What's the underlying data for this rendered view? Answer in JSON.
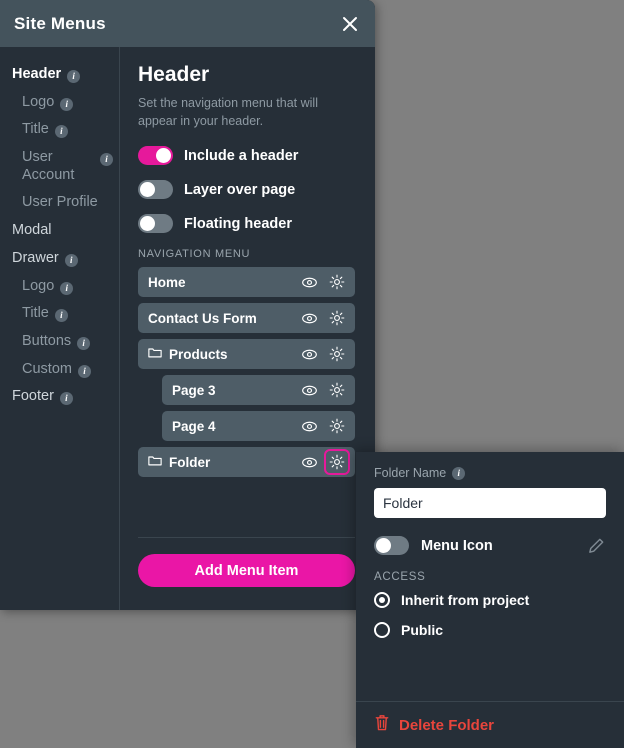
{
  "colors": {
    "accent": "#e6199b",
    "panel_bg": "#262f38",
    "header_bg": "#44535c",
    "row_bg": "#4e5d67",
    "danger": "#e8453c",
    "backdrop": "#808080"
  },
  "dialog": {
    "title": "Site Menus",
    "close_icon": "close-icon"
  },
  "sidebar": {
    "items": [
      {
        "label": "Header",
        "level": 0,
        "active": true,
        "info": true
      },
      {
        "label": "Logo",
        "level": 1,
        "active": false,
        "info": true
      },
      {
        "label": "Title",
        "level": 1,
        "active": false,
        "info": true
      },
      {
        "label": "User Account",
        "level": 1,
        "active": false,
        "info": true
      },
      {
        "label": "User Profile",
        "level": 1,
        "active": false,
        "info": false
      },
      {
        "label": "Modal",
        "level": 0,
        "active": false,
        "info": false
      },
      {
        "label": "Drawer",
        "level": 0,
        "active": false,
        "info": true
      },
      {
        "label": "Logo",
        "level": 1,
        "active": false,
        "info": true
      },
      {
        "label": "Title",
        "level": 1,
        "active": false,
        "info": true
      },
      {
        "label": "Buttons",
        "level": 1,
        "active": false,
        "info": true
      },
      {
        "label": "Custom",
        "level": 1,
        "active": false,
        "info": true
      },
      {
        "label": "Footer",
        "level": 0,
        "active": false,
        "info": true
      }
    ]
  },
  "main": {
    "title": "Header",
    "description": "Set the navigation menu that will appear in your header.",
    "toggles": [
      {
        "label": "Include a header",
        "on": true
      },
      {
        "label": "Layer over page",
        "on": false
      },
      {
        "label": "Floating header",
        "on": false
      }
    ],
    "nav_section_label": "NAVIGATION MENU",
    "menu_items": [
      {
        "label": "Home",
        "folder": false,
        "indent": false,
        "gear_highlighted": false
      },
      {
        "label": "Contact Us Form",
        "folder": false,
        "indent": false,
        "gear_highlighted": false
      },
      {
        "label": "Products",
        "folder": true,
        "indent": false,
        "gear_highlighted": false
      },
      {
        "label": "Page 3",
        "folder": false,
        "indent": true,
        "gear_highlighted": false
      },
      {
        "label": "Page 4",
        "folder": false,
        "indent": true,
        "gear_highlighted": false
      },
      {
        "label": "Folder",
        "folder": true,
        "indent": false,
        "gear_highlighted": true
      }
    ],
    "add_button": "Add Menu Item"
  },
  "popup": {
    "folder_name_label": "Folder Name",
    "folder_name_value": "Folder",
    "folder_name_placeholder": "Folder Name",
    "menu_icon_label": "Menu Icon",
    "menu_icon_on": false,
    "access_label": "ACCESS",
    "access_options": [
      {
        "label": "Inherit from project",
        "selected": true
      },
      {
        "label": "Public",
        "selected": false
      }
    ],
    "delete_label": "Delete Folder"
  }
}
